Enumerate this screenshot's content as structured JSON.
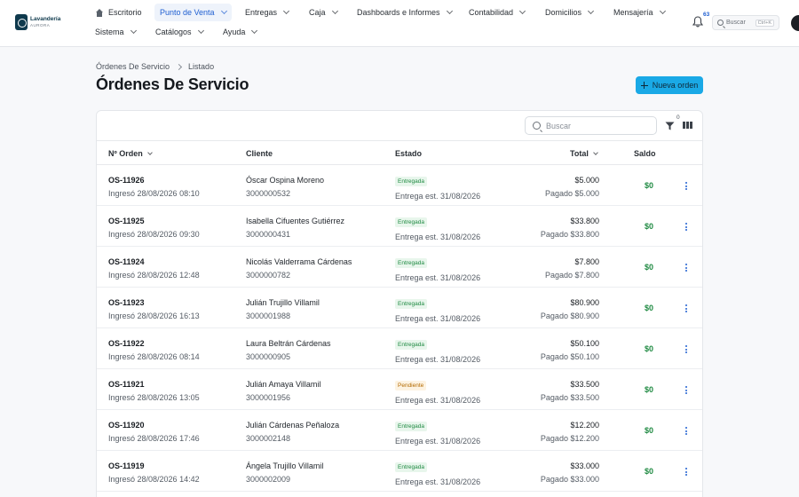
{
  "app": {
    "logo_name": "Lavandería",
    "logo_sub": "AURORA"
  },
  "nav": {
    "row1": [
      {
        "label": "Escritorio",
        "icon": "home-icon",
        "active": false
      },
      {
        "label": "Punto de Venta",
        "active": true
      },
      {
        "label": "Entregas"
      },
      {
        "label": "Caja"
      },
      {
        "label": "Dashboards e Informes"
      },
      {
        "label": "Contabilidad"
      },
      {
        "label": "Domicilios"
      },
      {
        "label": "Mensajería"
      }
    ],
    "row2": [
      {
        "label": "Sistema"
      },
      {
        "label": "Catálogos"
      },
      {
        "label": "Ayuda"
      }
    ],
    "notifications_count": "63",
    "search_placeholder": "Buscar",
    "search_shortcut": "Ctrl+K"
  },
  "breadcrumb": {
    "parent": "Órdenes De Servicio",
    "current": "Listado"
  },
  "page": {
    "title": "Órdenes De Servicio",
    "new_button": "Nueva orden"
  },
  "table": {
    "search_placeholder": "Buscar",
    "filter_count": "0",
    "headers": {
      "order": "Nº Orden",
      "client": "Cliente",
      "state": "Estado",
      "total": "Total",
      "saldo": "Saldo"
    },
    "rows": [
      {
        "id": "OS-11926",
        "date": "Ingresó 28/08/2026 08:10",
        "client": "Óscar Ospina Moreno",
        "phone": "3000000532",
        "state": "Entregada",
        "state_kind": "ok",
        "eta": "Entrega est. 31/08/2026",
        "total": "$5.000",
        "paid": "Pagado $5.000",
        "saldo": "$0"
      },
      {
        "id": "OS-11925",
        "date": "Ingresó 28/08/2026 09:30",
        "client": "Isabella Cifuentes Gutiérrez",
        "phone": "3000000431",
        "state": "Entregada",
        "state_kind": "ok",
        "eta": "Entrega est. 31/08/2026",
        "total": "$33.800",
        "paid": "Pagado $33.800",
        "saldo": "$0"
      },
      {
        "id": "OS-11924",
        "date": "Ingresó 28/08/2026 12:48",
        "client": "Nicolás Valderrama Cárdenas",
        "phone": "3000000782",
        "state": "Entregada",
        "state_kind": "ok",
        "eta": "Entrega est. 31/08/2026",
        "total": "$7.800",
        "paid": "Pagado $7.800",
        "saldo": "$0"
      },
      {
        "id": "OS-11923",
        "date": "Ingresó 28/08/2026 16:13",
        "client": "Julián Trujillo Villamil",
        "phone": "3000001988",
        "state": "Entregada",
        "state_kind": "ok",
        "eta": "Entrega est. 31/08/2026",
        "total": "$80.900",
        "paid": "Pagado $80.900",
        "saldo": "$0"
      },
      {
        "id": "OS-11922",
        "date": "Ingresó 28/08/2026 08:14",
        "client": "Laura Beltrán Cárdenas",
        "phone": "3000000905",
        "state": "Entregada",
        "state_kind": "ok",
        "eta": "Entrega est. 31/08/2026",
        "total": "$50.100",
        "paid": "Pagado $50.100",
        "saldo": "$0"
      },
      {
        "id": "OS-11921",
        "date": "Ingresó 28/08/2026 13:05",
        "client": "Julián Amaya Villamil",
        "phone": "3000001956",
        "state": "Pendiente",
        "state_kind": "pend",
        "eta": "Entrega est. 31/08/2026",
        "total": "$33.500",
        "paid": "Pagado $33.500",
        "saldo": "$0"
      },
      {
        "id": "OS-11920",
        "date": "Ingresó 28/08/2026 17:46",
        "client": "Julián Cárdenas Peñaloza",
        "phone": "3000002148",
        "state": "Entregada",
        "state_kind": "ok",
        "eta": "Entrega est. 31/08/2026",
        "total": "$12.200",
        "paid": "Pagado $12.200",
        "saldo": "$0"
      },
      {
        "id": "OS-11919",
        "date": "Ingresó 28/08/2026 14:42",
        "client": "Ángela Trujillo Villamil",
        "phone": "3000002009",
        "state": "Entregada",
        "state_kind": "ok",
        "eta": "Entrega est. 31/08/2026",
        "total": "$33.000",
        "paid": "Pagado $33.000",
        "saldo": "$0"
      }
    ]
  },
  "colors": {
    "accent": "#1f5fd1",
    "primary_button": "#1aa9e6",
    "success": "#1f8a42",
    "warning": "#b46a00"
  }
}
